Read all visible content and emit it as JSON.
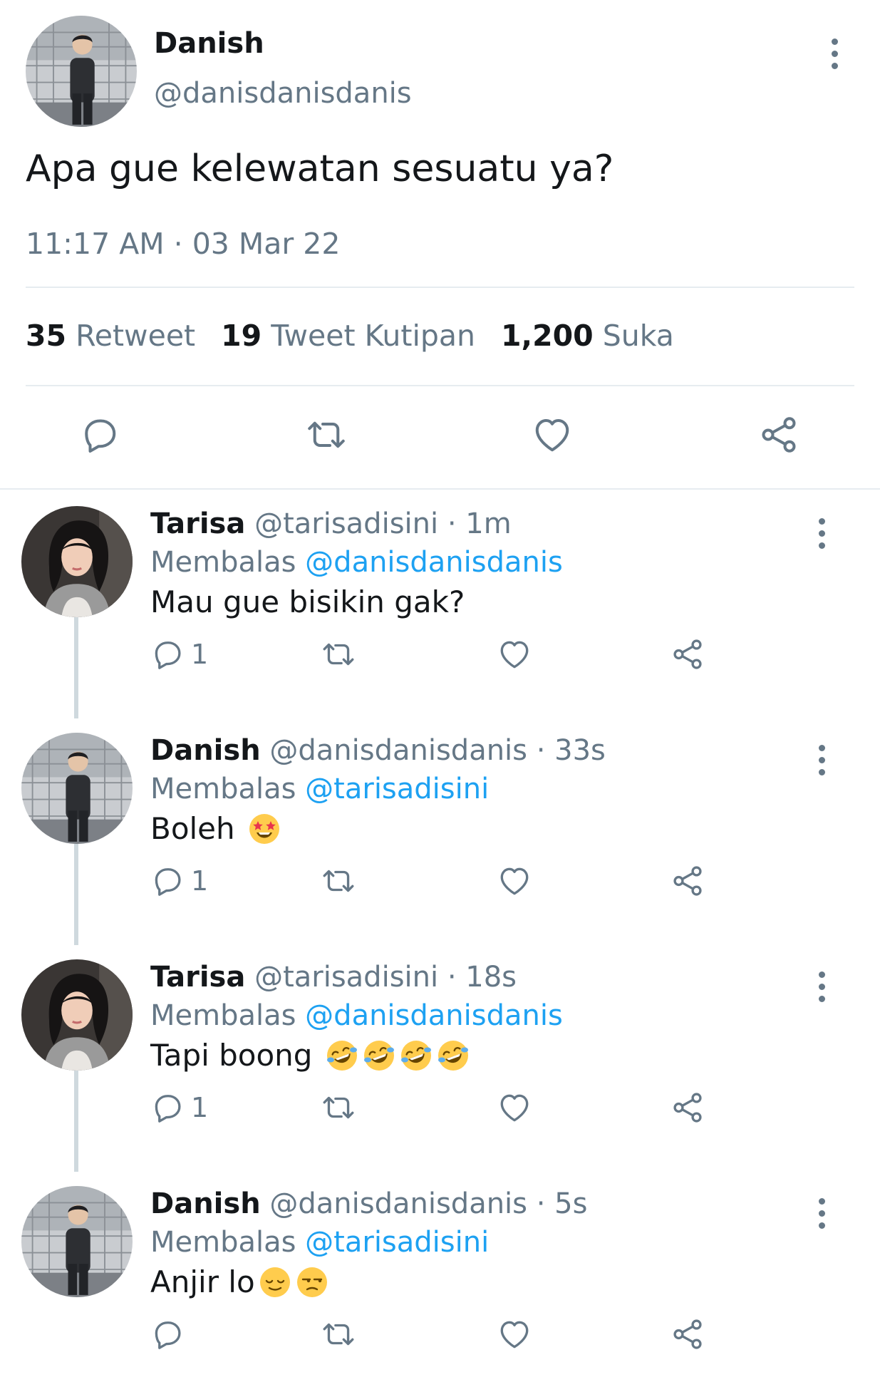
{
  "main_tweet": {
    "name": "Danish",
    "handle": "@danisdanisdanis",
    "text": "Apa gue kelewatan sesuatu ya?",
    "timestamp": "11:17 AM · 03 Mar 22",
    "stats": {
      "retweets_count": "35",
      "retweets_label": "Retweet",
      "quotes_count": "19",
      "quotes_label": "Tweet Kutipan",
      "likes_count": "1,200",
      "likes_label": "Suka"
    },
    "actions": [
      "reply-icon",
      "retweet-icon",
      "like-icon",
      "share-icon"
    ]
  },
  "replies": [
    {
      "name": "Tarisa",
      "handle_time": "@tarisadisini · 1m",
      "replying_label": "Membalas",
      "mention": "@danisdanisdanis",
      "text": "Mau gue bisikin gak?",
      "emoji": [],
      "reply_count": "1",
      "avatar": "tarisa"
    },
    {
      "name": "Danish",
      "handle_time": "@danisdanisdanis · 33s",
      "replying_label": "Membalas",
      "mention": "@tarisadisini",
      "text": "Boleh",
      "emoji": [
        "star-struck-emoji"
      ],
      "reply_count": "1",
      "avatar": "danish"
    },
    {
      "name": "Tarisa",
      "handle_time": "@tarisadisini · 18s",
      "replying_label": "Membalas",
      "mention": "@danisdanisdanis",
      "text": "Tapi boong",
      "emoji": [
        "rolling-laughing-emoji",
        "rolling-laughing-emoji",
        "rolling-laughing-emoji",
        "rolling-laughing-emoji"
      ],
      "reply_count": "1",
      "avatar": "tarisa"
    },
    {
      "name": "Danish",
      "handle_time": "@danisdanisdanis · 5s",
      "replying_label": "Membalas",
      "mention": "@tarisadisini",
      "text": "Anjir lo",
      "emoji": [
        "relieved-emoji",
        "unamused-emoji"
      ],
      "reply_count": "",
      "avatar": "danish"
    }
  ],
  "colors": {
    "accent": "#1da1f2",
    "secondary_text": "#657786",
    "primary_text": "#14171a",
    "divider": "#e6ecf0"
  }
}
